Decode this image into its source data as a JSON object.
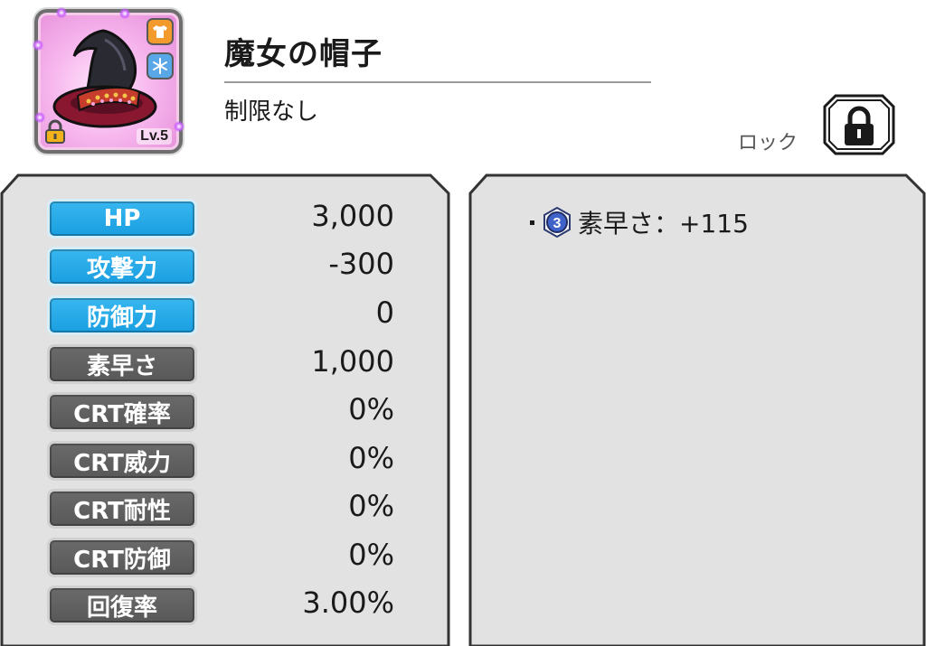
{
  "item": {
    "name": "魔女の帽子",
    "restriction": "制限なし",
    "level_label": "Lv.5",
    "rarity_color": "#e58ad8"
  },
  "lock": {
    "label": "ロック",
    "icon": "lock-icon"
  },
  "stats": [
    {
      "label": "HP",
      "value": "3,000",
      "style": "blue"
    },
    {
      "label": "攻撃力",
      "value": "-300",
      "style": "blue"
    },
    {
      "label": "防御力",
      "value": "0",
      "style": "blue"
    },
    {
      "label": "素早さ",
      "value": "1,000",
      "style": "gray"
    },
    {
      "label": "CRT確率",
      "value": "0%",
      "style": "gray"
    },
    {
      "label": "CRT威力",
      "value": "0%",
      "style": "gray"
    },
    {
      "label": "CRT耐性",
      "value": "0%",
      "style": "gray"
    },
    {
      "label": "CRT防御",
      "value": "0%",
      "style": "gray"
    },
    {
      "label": "回復率",
      "value": "3.00%",
      "style": "gray"
    }
  ],
  "effects": [
    {
      "level": "3",
      "text": "素早さ：+115"
    }
  ],
  "colors": {
    "stat_blue": "#1a9ee0",
    "stat_gray": "#585858",
    "panel_bg": "#e2e2e2"
  }
}
